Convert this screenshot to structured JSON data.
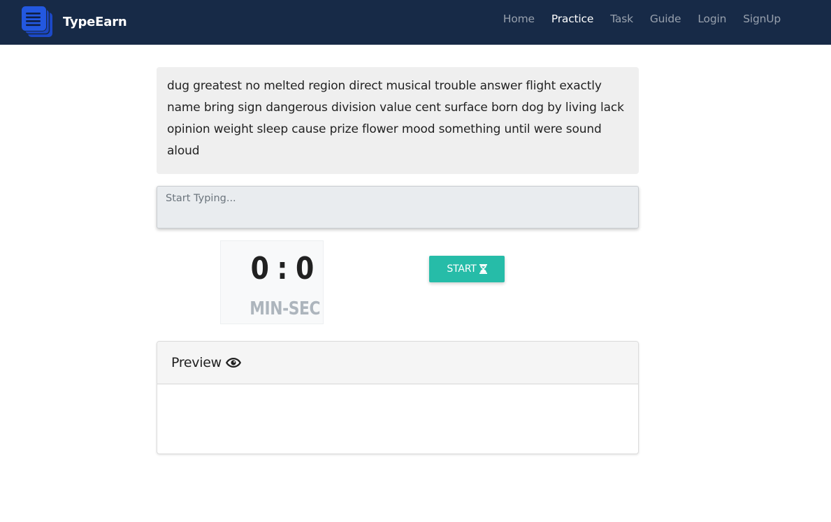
{
  "brand": {
    "name": "TypeEarn",
    "logo_icon": "stacked-documents-icon",
    "logo_color": "#2358e0"
  },
  "nav": {
    "items": [
      {
        "label": "Home",
        "active": false
      },
      {
        "label": "Practice",
        "active": true
      },
      {
        "label": "Task",
        "active": false
      },
      {
        "label": "Guide",
        "active": false
      },
      {
        "label": "Login",
        "active": false
      },
      {
        "label": "SignUp",
        "active": false
      }
    ]
  },
  "practice": {
    "prompt_text": "dug greatest no melted region direct musical trouble answer flight exactly name bring sign dangerous division value cent surface born dog by living lack opinion weight sleep cause prize flower mood something until were sound aloud",
    "input_placeholder": "Start Typing...",
    "input_value": ""
  },
  "timer": {
    "display": "0 : 0",
    "unit_label": "MIN-SEC"
  },
  "start_button": {
    "label": "START",
    "icon": "hourglass-icon",
    "color": "#26bca8"
  },
  "preview": {
    "title": "Preview",
    "icon": "eye-icon",
    "content": ""
  },
  "colors": {
    "navbar_bg": "#172a47",
    "prompt_bg": "#efefef",
    "accent": "#26bca8"
  }
}
